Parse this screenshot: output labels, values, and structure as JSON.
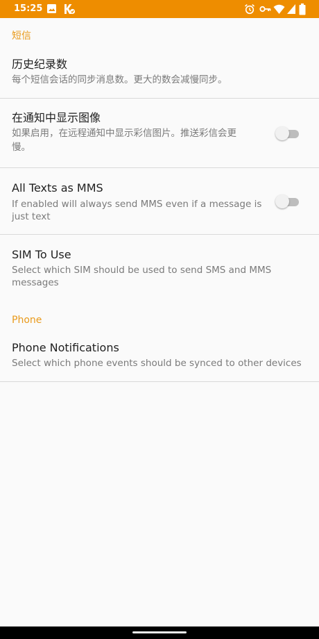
{
  "status_bar": {
    "time": "15:25",
    "background": "#ee8d00",
    "left_icons": [
      "image-icon",
      "k-notification-icon"
    ],
    "right_icons": [
      "alarm-icon",
      "key-icon",
      "wifi-icon",
      "signal-icon",
      "battery-icon"
    ]
  },
  "sections": [
    {
      "header": "短信",
      "items": [
        {
          "title": "历史纪录数",
          "summary": "每个短信会话的同步消息数。更大的数会减慢同步。"
        },
        {
          "title": "在通知中显示图像",
          "summary_line1": "如果启用，在远程通知中显示彩信图片。推送彩信会更",
          "summary_line2": "慢。",
          "switch_on": false
        },
        {
          "title": "All Texts as MMS",
          "summary_line1": "If enabled will always send MMS even if a message is",
          "summary_line2": "just text",
          "switch_on": false
        },
        {
          "title": "SIM To Use",
          "summary_line1": "Select which SIM should be used to send SMS and MMS",
          "summary_line2": "messages"
        }
      ]
    },
    {
      "header": "Phone",
      "items": [
        {
          "title": "Phone Notifications",
          "summary": "Select which phone events should be synced to other devices"
        }
      ]
    }
  ],
  "accent_color": "#e99a1b"
}
